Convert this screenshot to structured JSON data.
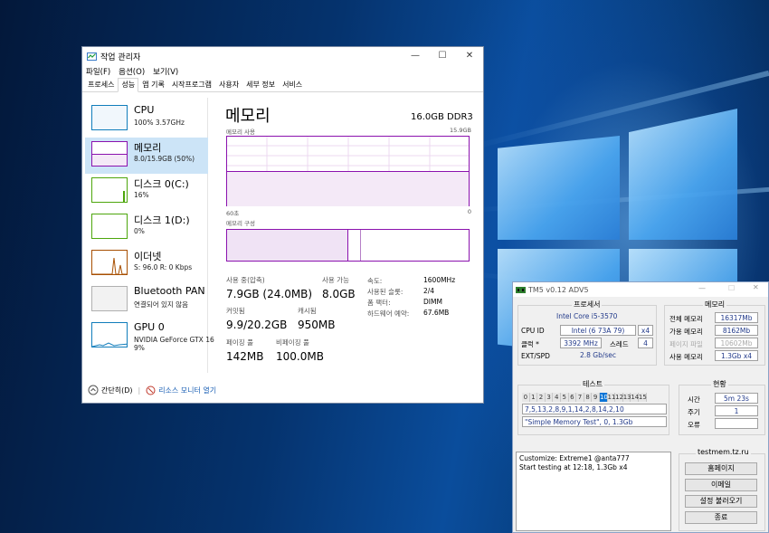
{
  "task_manager": {
    "title": "작업 관리자",
    "menu": [
      "파일(F)",
      "옵션(O)",
      "보기(V)"
    ],
    "tabs": [
      "프로세스",
      "성능",
      "앱 기록",
      "시작프로그램",
      "사용자",
      "세부 정보",
      "서비스"
    ],
    "active_tab": "성능",
    "window_buttons": {
      "minimize": "—",
      "maximize": "☐",
      "close": "✕"
    },
    "sidebar": [
      {
        "name": "CPU",
        "sub": "100% 3.57GHz",
        "color": "#117dbb"
      },
      {
        "name": "메모리",
        "sub": "8.0/15.9GB (50%)",
        "color": "#8b12ae"
      },
      {
        "name": "디스크 0(C:)",
        "sub": "16%",
        "color": "#4da60c"
      },
      {
        "name": "디스크 1(D:)",
        "sub": "0%",
        "color": "#4da60c"
      },
      {
        "name": "이더넷",
        "sub": "S: 96.0  R: 0 Kbps",
        "color": "#a74f01"
      },
      {
        "name": "Bluetooth PAN",
        "sub": "연결되어 있지 않음",
        "color": "#a0a0a0"
      },
      {
        "name": "GPU 0",
        "sub": "NVIDIA GeForce GTX 16",
        "sub2": "9%",
        "color": "#117dbb"
      }
    ],
    "main": {
      "title": "메모리",
      "capacity": "16.0GB DDR3",
      "usage_label": "메모리 사용",
      "usage_max": "15.9GB",
      "time_left": "60초",
      "time_right": "0",
      "composition_label": "메모리 구성",
      "stats": [
        {
          "label": "사용 중(압축)",
          "value": "7.9GB (24.0MB)"
        },
        {
          "label": "사용 가능",
          "value": "8.0GB"
        },
        {
          "label": "커밋됨",
          "value": "9.9/20.2GB"
        },
        {
          "label": "캐시됨",
          "value": "950MB"
        },
        {
          "label": "페이징 풀",
          "value": "142MB"
        },
        {
          "label": "비페이징 풀",
          "value": "100.0MB"
        }
      ],
      "kv": [
        {
          "label": "속도:",
          "value": "1600MHz"
        },
        {
          "label": "사용된 슬롯:",
          "value": "2/4"
        },
        {
          "label": "폼 팩터:",
          "value": "DIMM"
        },
        {
          "label": "하드웨어 예약:",
          "value": "67.6MB"
        }
      ],
      "usage_fraction": 0.5
    },
    "footer": {
      "collapse": "간단히(D)",
      "monitor": "리소스 모니터 열기"
    }
  },
  "tm5": {
    "title": "TM5 v0.12 ADV5",
    "cpu_group": "프로세서",
    "cpu_name": "Intel Core i5-3570",
    "cpu_id_label": "CPU ID",
    "cpu_id_value": "Intel  (6 73A 79)",
    "cpu_cores": "x4",
    "clock_label": "클럭 *",
    "clock_value": "3392 MHz",
    "thread_label": "스레드",
    "thread_value": "4",
    "ext_label": "EXT/SPD",
    "ext_value": "2.8 Gb/sec",
    "mem_group": "메모리",
    "mem_rows": [
      {
        "label": "전체 메모리",
        "value": "16317Mb"
      },
      {
        "label": "가용 메모리",
        "value": "8162Mb"
      },
      {
        "label": "페이지 파일",
        "value": "10602Mb"
      },
      {
        "label": "사용 메모리",
        "value": "1.3Gb x4"
      }
    ],
    "test_group": "테스트",
    "test_cells": [
      "0",
      "1",
      "2",
      "3",
      "4",
      "5",
      "6",
      "7",
      "8",
      "9",
      "10",
      "11",
      "12",
      "13",
      "14",
      "15"
    ],
    "active_test": "10",
    "test_sequence": "7,5,13,2,8,9,1,14,2,8,14,2,10",
    "test_desc": "\"Simple Memory Test\", 0, 1.3Gb",
    "status_group": "현황",
    "status_rows": [
      {
        "label": "시간",
        "value": "5m 23s"
      },
      {
        "label": "주기",
        "value": "1"
      },
      {
        "label": "오류",
        "value": ""
      }
    ],
    "log_lines": [
      "Customize: Extreme1 @anta777",
      "Start testing at 12:18, 1.3Gb x4"
    ],
    "site_group": "testmem.tz.ru",
    "buttons": [
      "홈페이지",
      "이메일",
      "설정 불러오기",
      "종료"
    ]
  }
}
